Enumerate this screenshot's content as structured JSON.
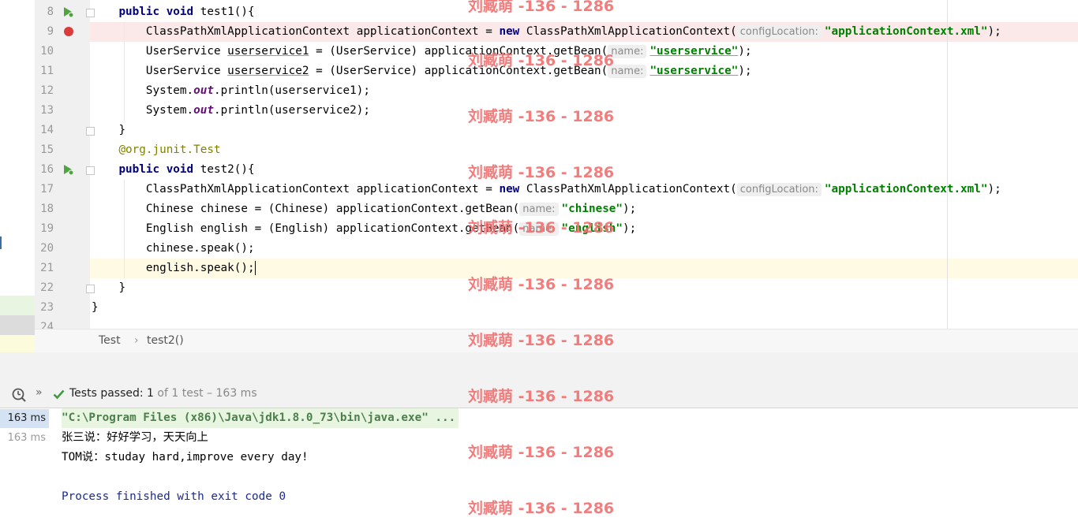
{
  "editor": {
    "line_numbers": [
      "8",
      "9",
      "10",
      "11",
      "12",
      "13",
      "14",
      "15",
      "16",
      "17",
      "18",
      "19",
      "20",
      "21",
      "22",
      "23",
      "24"
    ],
    "lines": {
      "l8": {
        "kw1": "public",
        "kw2": "void",
        "rest": " test1(){"
      },
      "l9": {
        "a": "ClassPathXmlApplicationContext applicationContext = ",
        "kw": "new",
        "b": " ClassPathXmlApplicationContext(",
        "hint": "configLocation:",
        "str": "\"applicationContext.xml\"",
        "end": ");"
      },
      "l10": {
        "a": "UserService ",
        "var": "userservice1",
        "b": " = (UserService) applicationContext.getBean(",
        "hint": "name:",
        "str": "\"userservice\"",
        "end": ");"
      },
      "l11": {
        "a": "UserService ",
        "var": "userservice2",
        "b": " = (UserService) applicationContext.getBean(",
        "hint": "name:",
        "str": "\"userservice\"",
        "end": ");"
      },
      "l12": {
        "a": "System.",
        "fld": "out",
        "b": ".println(userservice1);"
      },
      "l13": {
        "a": "System.",
        "fld": "out",
        "b": ".println(userservice2);"
      },
      "l14": "}",
      "l15": {
        "ann": "@org.junit.",
        "cls": "Test"
      },
      "l16": {
        "kw1": "public",
        "kw2": "void",
        "rest": " test2(){"
      },
      "l17": {
        "a": "ClassPathXmlApplicationContext applicationContext = ",
        "kw": "new",
        "b": " ClassPathXmlApplicationContext(",
        "hint": "configLocation:",
        "str": "\"applicationContext.xml\"",
        "end": ");"
      },
      "l18": {
        "a": "Chinese chinese = (Chinese) applicationContext.getBean(",
        "hint": "name:",
        "str": "\"chinese\"",
        "end": ");"
      },
      "l19": {
        "a": "English english = (English) applicationContext.getBean(",
        "hint": "name:",
        "str": "\"english\"",
        "end": ");"
      },
      "l20": "chinese.speak();",
      "l21": "english.speak();",
      "l22": "}",
      "l23": "}"
    }
  },
  "breadcrumb": {
    "class": "Test",
    "separator": "›",
    "method": "test2()"
  },
  "run_toolbar": {
    "status": "Tests passed:",
    "passed": "1",
    "detail": "of 1 test – 163 ms",
    "chevron": "»"
  },
  "test_tree": {
    "rows": [
      "163 ms",
      "163 ms"
    ]
  },
  "console": {
    "cmd": "\"C:\\Program Files (x86)\\Java\\jdk1.8.0_73\\bin\\java.exe\" ...",
    "out1": "张三说：好好学习，天天向上",
    "out2": "TOM说：studay hard,improve every day!",
    "finish": "Process finished with exit code 0"
  },
  "watermark": "刘臧萌 -136 - 1286",
  "colors": {
    "keyword": "#000080",
    "string": "#008000",
    "annotation": "#808000",
    "breakpoint": "#db3b3b",
    "current_line": "#fffae3",
    "breakpoint_line": "#fbe8e8",
    "pass": "#3f9a3f"
  }
}
